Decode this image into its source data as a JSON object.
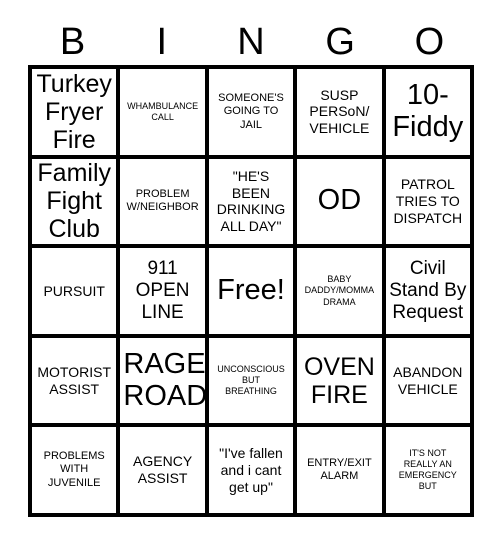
{
  "header": {
    "letters": [
      "B",
      "I",
      "N",
      "G",
      "O"
    ]
  },
  "grid": {
    "columns": 5,
    "rows": 5,
    "cells": [
      {
        "text": "Turkey\nFryer\nFire",
        "size": "s-xl"
      },
      {
        "text": "WHAMBULANCE\nCALL",
        "size": "s-xs"
      },
      {
        "text": "SOMEONE'S\nGOING TO\nJAIL",
        "size": "s-sm"
      },
      {
        "text": "SUSP\nPERSoN/\nVEHICLE",
        "size": "s-md"
      },
      {
        "text": "10-\nFiddy",
        "size": "s-xxl"
      },
      {
        "text": "Family\nFight\nClub",
        "size": "s-xl"
      },
      {
        "text": "PROBLEM\nW/NEIGHBOR",
        "size": "s-sm"
      },
      {
        "text": "\"HE'S\nBEEN\nDRINKING\nALL DAY\"",
        "size": "s-md"
      },
      {
        "text": "OD",
        "size": "s-xxl"
      },
      {
        "text": "PATROL\nTRIES TO\nDISPATCH",
        "size": "s-md"
      },
      {
        "text": "PURSUIT",
        "size": "s-md"
      },
      {
        "text": "911\nOPEN\nLINE",
        "size": "s-lg"
      },
      {
        "text": "Free!",
        "size": "s-xxl"
      },
      {
        "text": "BABY\nDADDY/MOMMA\nDRAMA",
        "size": "s-xs"
      },
      {
        "text": "Civil\nStand By\nRequest",
        "size": "s-lg"
      },
      {
        "text": "MOTORIST\nASSIST",
        "size": "s-md"
      },
      {
        "text": "RAGE\nROAD",
        "size": "s-xxl"
      },
      {
        "text": "UNCONSCIOUS\nBUT\nBREATHING",
        "size": "s-xs"
      },
      {
        "text": "OVEN\nFIRE",
        "size": "s-xl"
      },
      {
        "text": "ABANDON\nVEHICLE",
        "size": "s-md"
      },
      {
        "text": "PROBLEMS\nWITH\nJUVENILE",
        "size": "s-sm"
      },
      {
        "text": "AGENCY\nASSIST",
        "size": "s-md"
      },
      {
        "text": "\"I've fallen\nand i cant\nget up\"",
        "size": "s-md"
      },
      {
        "text": "ENTRY/EXIT\nALARM",
        "size": "s-sm"
      },
      {
        "text": "IT'S NOT\nREALLY AN\nEMERGENCY\nBUT",
        "size": "s-xs"
      }
    ]
  },
  "colors": {
    "ink": "#000000",
    "paper": "#ffffff"
  }
}
